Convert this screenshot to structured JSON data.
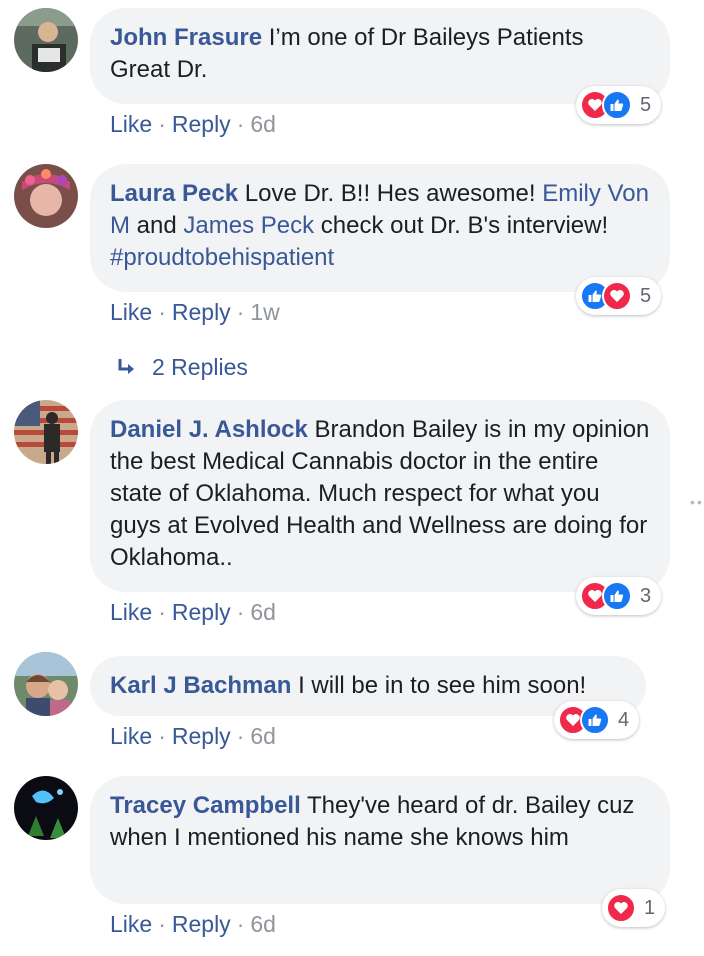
{
  "comments": [
    {
      "author": "John Frasure",
      "text_parts": [
        {
          "t": "I’m one of Dr Baileys Patients Great Dr.",
          "k": "plain"
        }
      ],
      "like_label": "Like",
      "reply_label": "Reply",
      "time": "6d",
      "reactions": [
        "love",
        "like"
      ],
      "reaction_count": "5"
    },
    {
      "author": "Laura Peck",
      "text_parts": [
        {
          "t": "Love Dr. B!! Hes awesome! ",
          "k": "plain"
        },
        {
          "t": "Emily Von M",
          "k": "mention"
        },
        {
          "t": " and ",
          "k": "plain"
        },
        {
          "t": "James Peck",
          "k": "mention"
        },
        {
          "t": " check out Dr. B's interview! ",
          "k": "plain"
        },
        {
          "t": "#proudtobehispatient",
          "k": "hashtag"
        }
      ],
      "like_label": "Like",
      "reply_label": "Reply",
      "time": "1w",
      "reactions": [
        "like",
        "love"
      ],
      "reaction_count": "5",
      "replies_label": "2 Replies"
    },
    {
      "author": "Daniel J. Ashlock",
      "text_parts": [
        {
          "t": "Brandon Bailey is in my opinion the best Medical Cannabis doctor in the entire state of Oklahoma. Much respect for what you guys at Evolved Health and Wellness are doing for Oklahoma..",
          "k": "plain"
        }
      ],
      "like_label": "Like",
      "reply_label": "Reply",
      "time": "6d",
      "reactions": [
        "love",
        "like"
      ],
      "reaction_count": "3"
    },
    {
      "author": "Karl J Bachman",
      "text_parts": [
        {
          "t": "I will be in to see him soon!",
          "k": "plain"
        }
      ],
      "like_label": "Like",
      "reply_label": "Reply",
      "time": "6d",
      "reactions": [
        "love",
        "like"
      ],
      "reaction_count": "4"
    },
    {
      "author": "Tracey Campbell",
      "text_parts": [
        {
          "t": "They've heard of dr. Bailey cuz when I mentioned his name she knows him",
          "k": "plain"
        }
      ],
      "like_label": "Like",
      "reply_label": "Reply",
      "time": "6d",
      "reactions": [
        "love"
      ],
      "reaction_count": "1"
    }
  ],
  "colors": {
    "link": "#385898",
    "bubble": "#f2f3f5",
    "love": "#f0284a",
    "like": "#1877f2"
  },
  "icons": {
    "love": "heart-icon",
    "like": "thumbs-up-icon",
    "reply_arrow": "reply-arrow-icon"
  }
}
